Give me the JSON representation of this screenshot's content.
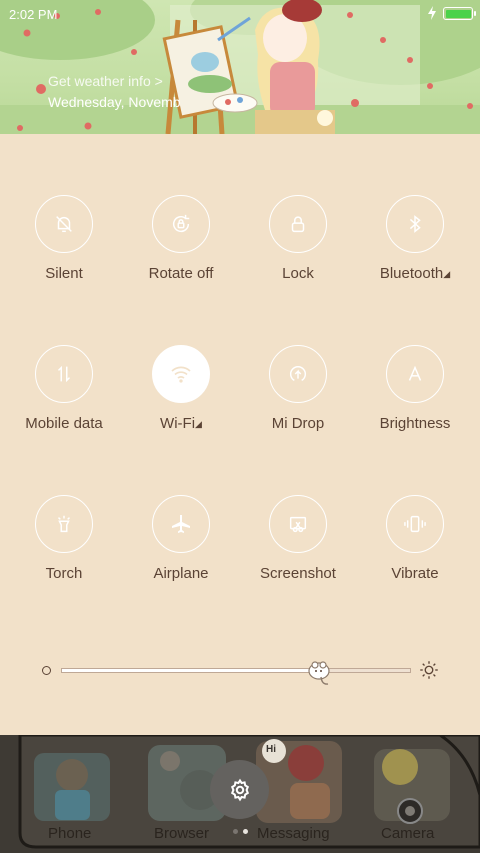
{
  "status_bar": {
    "time": "2:02 PM"
  },
  "header": {
    "weather_link": "Get weather info >",
    "date": "Wednesday, Novemb"
  },
  "tiles": [
    {
      "label": "Silent",
      "icon": "bell-off-icon"
    },
    {
      "label": "Rotate off",
      "icon": "rotate-lock-icon"
    },
    {
      "label": "Lock",
      "icon": "lock-icon"
    },
    {
      "label": "Bluetooth",
      "icon": "bluetooth-icon",
      "has_menu": true
    },
    {
      "label": "Mobile data",
      "icon": "mobile-data-icon"
    },
    {
      "label": "Wi-Fi",
      "icon": "wifi-icon",
      "has_menu": true,
      "active": true
    },
    {
      "label": "Mi Drop",
      "icon": "mi-drop-icon"
    },
    {
      "label": "Brightness",
      "icon": "auto-brightness-icon"
    },
    {
      "label": "Torch",
      "icon": "torch-icon"
    },
    {
      "label": "Airplane",
      "icon": "airplane-icon"
    },
    {
      "label": "Screenshot",
      "icon": "screenshot-icon"
    },
    {
      "label": "Vibrate",
      "icon": "vibrate-icon"
    }
  ],
  "brightness": {
    "level": 0.73
  },
  "dock": {
    "apps": [
      {
        "label": "Phone"
      },
      {
        "label": "Browser"
      },
      {
        "label": "Messaging"
      },
      {
        "label": "Camera"
      }
    ],
    "bubble_text": "Hi"
  },
  "colors": {
    "panel_background": "#f2e1c9",
    "label_text": "#5b4335",
    "active_tile": "#ffffff",
    "battery": "#4ad24a"
  }
}
